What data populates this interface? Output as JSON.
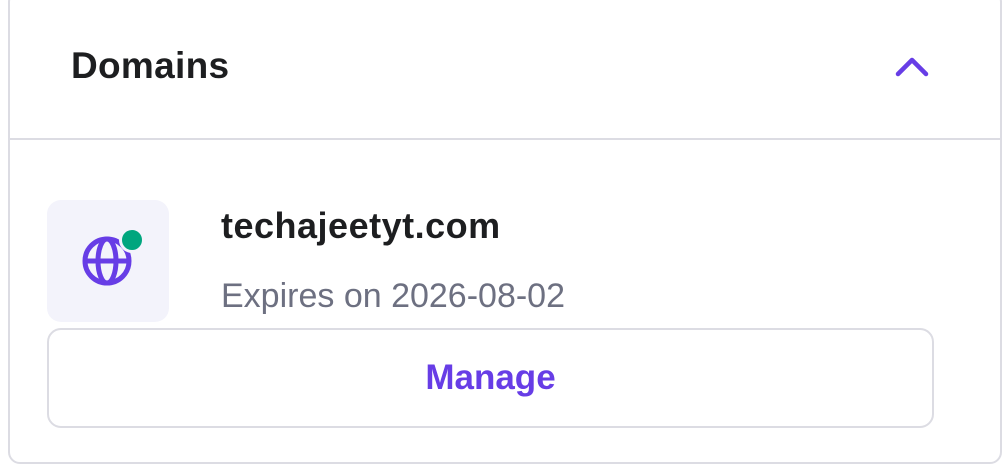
{
  "card": {
    "title": "Domains",
    "collapse_icon": "chevron-up-icon"
  },
  "domain": {
    "icon": "globe-icon",
    "status": "active",
    "name": "techajeetyt.com",
    "expiry": "Expires on 2026-08-02"
  },
  "actions": {
    "manage_label": "Manage"
  },
  "colors": {
    "accent": "#673de6",
    "status_active": "#00a67e",
    "text_primary": "#1d1e20",
    "text_secondary": "#6d7081",
    "border": "#dcdce3",
    "icon_bg": "#f3f3fb"
  }
}
